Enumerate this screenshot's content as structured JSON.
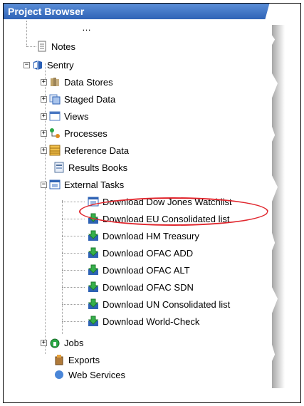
{
  "window": {
    "title": "Project Browser"
  },
  "tree": {
    "truncated_top": "…",
    "notes": "Notes",
    "sentry": "Sentry",
    "data_stores": "Data Stores",
    "staged_data": "Staged Data",
    "views": "Views",
    "processes": "Processes",
    "reference_data": "Reference Data",
    "results_books": "Results Books",
    "external_tasks": "External Tasks",
    "tasks": [
      "Download Dow Jones Watchlist",
      "Download EU Consolidated list",
      "Download HM Treasury",
      "Download OFAC ADD",
      "Download OFAC ALT",
      "Download OFAC SDN",
      "Download UN Consolidated list",
      "Download World-Check"
    ],
    "jobs": "Jobs",
    "exports": "Exports",
    "web_services": "Web Services"
  },
  "colors": {
    "highlight": "#e0262d",
    "title_bg": "#2f63b6"
  }
}
